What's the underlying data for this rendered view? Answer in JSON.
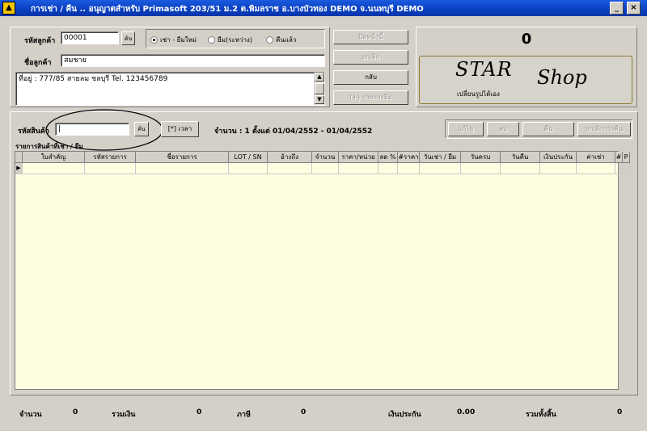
{
  "window": {
    "logo_glyph": "▲",
    "title": "การเช่า / คืน .. อนุญาตสำหรับ Primasoft 203/51 ม.2 ต.พิมลราช อ.บางบัวทอง DEMO จ.นนทบุรี DEMO",
    "minimize_glyph": "_",
    "close_glyph": "×"
  },
  "customer": {
    "code_label": "รหัสลูกค้า",
    "code_value": "00001",
    "search_button": "ค้น",
    "name_label": "ชื่อลูกค้า",
    "name_value": "สมชาย",
    "address": "ที่อยู่ : 777/85 สายลม ชลบุรี  Tel. 123456789",
    "radio": [
      {
        "label": "เช่า - ยืมใหม่",
        "checked": true
      },
      {
        "label": "ยืม(ระหว่าง)",
        "checked": false
      },
      {
        "label": "คืนแล้ว",
        "checked": false
      }
    ]
  },
  "side_buttons": {
    "close_bill": "ปิดหน้านี้",
    "cancel_bill": "ยกเลิก",
    "back": "กลับ",
    "add_item": "(+) รายการยืม"
  },
  "shop": {
    "counter": "0",
    "brand_star": "STAR",
    "brand_shop": "Shop",
    "tagline": "เปลี่ยนรูปได้เอง"
  },
  "product": {
    "code_label": "รหัสสินค้า",
    "code_value": "|",
    "search_button": "ค้น",
    "time_button": "[*] เวลา",
    "summary": "จำนวน : 1  ตั้งแต่ 01/04/2552 - 01/04/2552",
    "action_buttons": [
      "แก้ไข",
      "ลบ",
      "คืน",
      "ยกเลิกการคืน"
    ]
  },
  "grid": {
    "caption": "รายการสินค้าที่เช่า / ยืม",
    "row_marker": "▶",
    "columns": [
      "ใบสำคัญ",
      "รหัสรายการ",
      "ชื่อรายการ",
      "LOT / SN",
      "อ้างถึง",
      "จำนวน",
      "ราคา/หน่วย",
      "ลด %",
      "#ราคา",
      "วันเช่า / ยืม",
      "วันครบ",
      "วันคืน",
      "เงินประกัน",
      "ค่าเช่า",
      "#",
      "P"
    ]
  },
  "footer": {
    "qty_label": "จำนวน",
    "qty_value": "0",
    "total_label": "รวมเงิน",
    "total_value": "0",
    "tax_label": "ภาษี",
    "tax_value": "0",
    "deposit_label": "เงินประกัน",
    "deposit_value": "0.00",
    "grand_label": "รวมทั้งสิ้น",
    "grand_value": "0"
  }
}
